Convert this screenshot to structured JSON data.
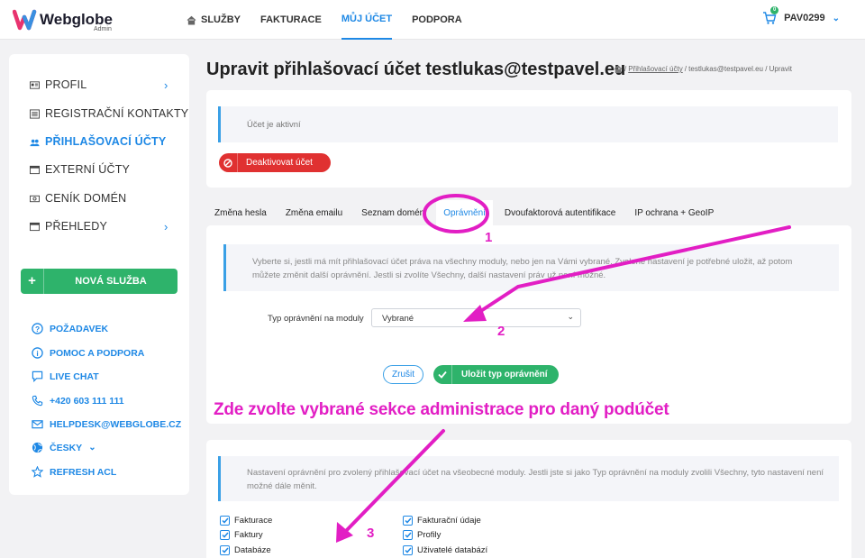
{
  "brand": {
    "name": "Webglobe",
    "sub": "Admin"
  },
  "nav": {
    "items": [
      {
        "label": "SLUŽBY"
      },
      {
        "label": "FAKTURACE"
      },
      {
        "label": "MŮJ ÚČET"
      },
      {
        "label": "PODPORA"
      }
    ],
    "cart_count": "0",
    "account": "PAV0299"
  },
  "sidebar": {
    "items": [
      {
        "label": "PROFIL",
        "icon": "id-card-icon"
      },
      {
        "label": "REGISTRAČNÍ KONTAKTY",
        "icon": "list-icon"
      },
      {
        "label": "PŘIHLAŠOVACÍ ÚČTY",
        "icon": "users-icon"
      },
      {
        "label": "EXTERNÍ ÚČTY",
        "icon": "window-icon"
      },
      {
        "label": "CENÍK DOMÉN",
        "icon": "money-icon"
      },
      {
        "label": "PŘEHLEDY",
        "icon": "window-icon"
      }
    ],
    "new_service": "NOVÁ SLUŽBA",
    "support": [
      {
        "label": "POŽADAVEK"
      },
      {
        "label": "POMOC A PODPORA"
      },
      {
        "label": "LIVE CHAT"
      },
      {
        "label": "+420 603 111 111"
      },
      {
        "label": "HELPDESK@WEBGLOBE.CZ"
      },
      {
        "label": "ČESKY"
      },
      {
        "label": "REFRESH ACL"
      }
    ]
  },
  "page": {
    "title": "Upravit přihlašovací účet testlukas@testpavel.eu",
    "breadcrumb": {
      "sep": "/",
      "link": "Přihlašovací účty",
      "rest": "/ testlukas@testpavel.eu / Upravit"
    }
  },
  "status": {
    "text": "Účet je aktivní",
    "deactivate": "Deaktivovat účet"
  },
  "tabs": [
    {
      "label": "Změna hesla"
    },
    {
      "label": "Změna emailu"
    },
    {
      "label": "Seznam domén"
    },
    {
      "label": "Oprávnění"
    },
    {
      "label": "Dvoufaktorová autentifikace"
    },
    {
      "label": "IP ochrana + GeoIP"
    }
  ],
  "permissions": {
    "info": "Vyberte si, jestli má mít přihlašovací účet práva na všechny moduly, nebo jen na Vámi vybrané. Zvolené nastavení je potřebné uložit, až potom můžete změnit další oprávnění. Jestli si zvolíte Všechny, další nastavení práv už není možné.",
    "select_label": "Typ oprávnění na moduly",
    "select_value": "Vybrané",
    "cancel": "Zrušit",
    "save": "Uložit typ oprávnění"
  },
  "modules": {
    "info": "Nastavení oprávnění pro zvolený přihlašovací účet na všeobecné moduly. Jestli jste si jako Typ oprávnění na moduly zvolili Všechny, tyto nastavení není možné dále měnit.",
    "left": [
      {
        "label": "Fakturace"
      },
      {
        "label": "Faktury"
      },
      {
        "label": "Databáze"
      }
    ],
    "right": [
      {
        "label": "Fakturační údaje"
      },
      {
        "label": "Profily"
      },
      {
        "label": "Uživatelé databází"
      }
    ]
  },
  "annotations": {
    "caption": "Zde zvolte vybrané sekce administrace pro daný podúčet",
    "n1": "1",
    "n2": "2",
    "n3": "3",
    "color": "#e21ec4"
  },
  "colors": {
    "accent": "#1e88e5",
    "success": "#2eb36b",
    "danger": "#e03131"
  }
}
